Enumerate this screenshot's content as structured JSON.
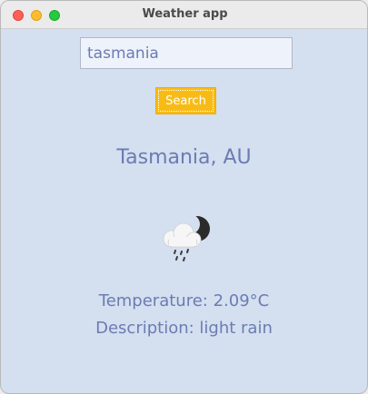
{
  "window": {
    "title": "Weather app"
  },
  "search": {
    "value": "tasmania",
    "button_label": "Search"
  },
  "result": {
    "city": "Tasmania, AU",
    "icon": "moon-cloud-rain-icon",
    "temperature": "Temperature: 2.09°C",
    "description": "Description: light rain"
  },
  "colors": {
    "background": "#d4dff0",
    "text": "#6b7cb2",
    "button": "#f8bb16"
  }
}
